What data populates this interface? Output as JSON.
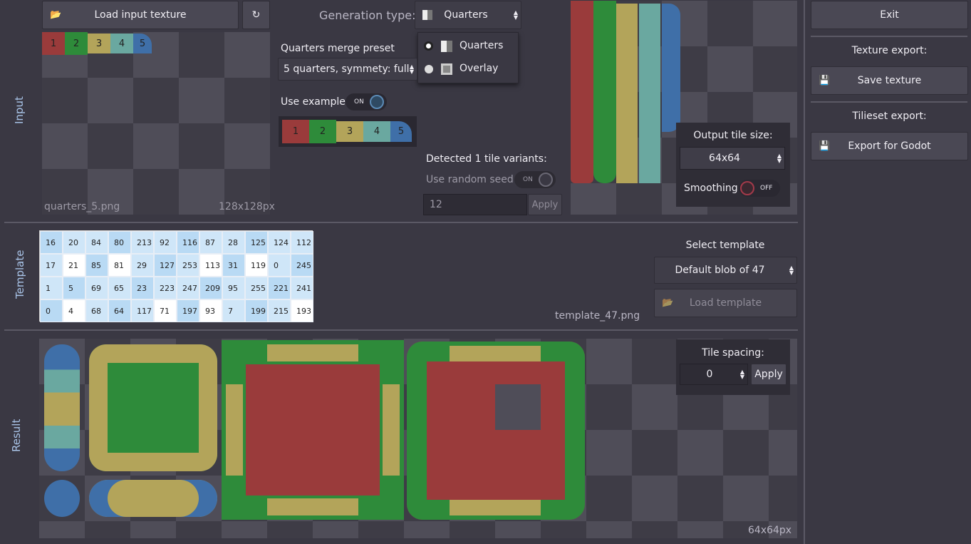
{
  "input": {
    "section_label": "Input",
    "load_button": "Load input texture",
    "reload_icon": "↻",
    "file_name": "quarters_5.png",
    "file_size": "128x128px",
    "tiles": [
      "1",
      "2",
      "3",
      "4",
      "5"
    ]
  },
  "generation": {
    "label": "Generation type:",
    "selected": "Quarters",
    "options": [
      "Quarters",
      "Overlay"
    ]
  },
  "merge_preset": {
    "label": "Quarters merge preset",
    "value": "5 quarters, symmety: full"
  },
  "use_example": {
    "label": "Use example",
    "state": "ON"
  },
  "detected": {
    "label": "Detected 1 tile variants:"
  },
  "random_seed": {
    "label": "Use random seed",
    "state": "ON",
    "value": "12",
    "apply": "Apply"
  },
  "output": {
    "label": "Output tile size:",
    "value": "64x64",
    "smoothing_label": "Smoothing",
    "smoothing_state": "OFF"
  },
  "right_panel": {
    "exit": "Exit",
    "texture_export_label": "Texture export:",
    "save_texture": "Save texture",
    "tileset_export_label": "Tilieset export:",
    "export_godot": "Export for Godot"
  },
  "template": {
    "section_label": "Template",
    "rows": [
      [
        "16",
        "20",
        "84",
        "80",
        "213",
        "92",
        "116",
        "87",
        "28",
        "125",
        "124",
        "112"
      ],
      [
        "17",
        "21",
        "85",
        "81",
        "29",
        "127",
        "253",
        "113",
        "31",
        "119",
        "0",
        "245"
      ],
      [
        "1",
        "5",
        "69",
        "65",
        "23",
        "223",
        "247",
        "209",
        "95",
        "255",
        "221",
        "241"
      ],
      [
        "0",
        "4",
        "68",
        "64",
        "117",
        "71",
        "197",
        "93",
        "7",
        "199",
        "215",
        "193"
      ]
    ],
    "file_name": "template_47.png",
    "select_label": "Select template",
    "select_value": "Default blob of 47",
    "load_template": "Load template"
  },
  "result": {
    "section_label": "Result",
    "spacing_label": "Tile spacing:",
    "spacing_value": "0",
    "apply": "Apply",
    "size": "64x64px"
  },
  "colors": {
    "red": "#9a3b3b",
    "green": "#2e8b3a",
    "yellow": "#b3a45a",
    "teal": "#6aa8a0",
    "blue": "#3f6fa8",
    "accent": "#a9c4e8"
  }
}
